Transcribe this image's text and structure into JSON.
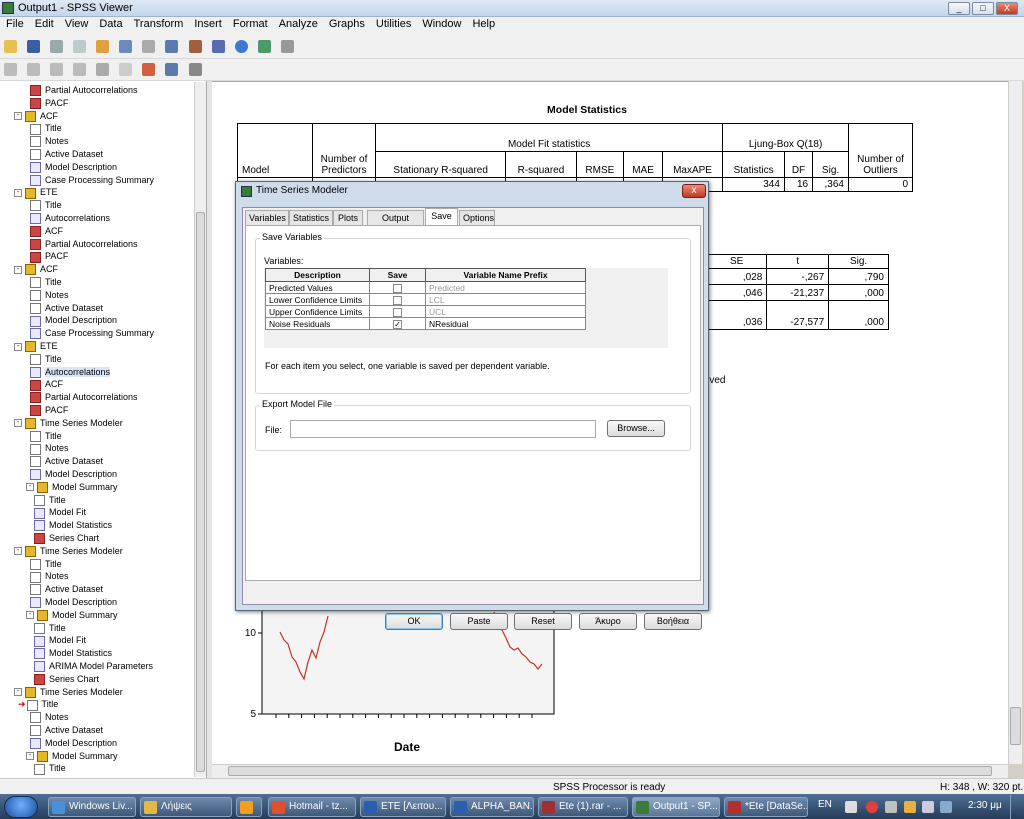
{
  "window": {
    "title": "Output1 - SPSS Viewer",
    "min": "_",
    "max": "□",
    "close": "X"
  },
  "menu": [
    "File",
    "Edit",
    "View",
    "Data",
    "Transform",
    "Insert",
    "Format",
    "Analyze",
    "Graphs",
    "Utilities",
    "Window",
    "Help"
  ],
  "tree": [
    {
      "label": "Partial Autocorrelations",
      "icon": "chart"
    },
    {
      "label": "PACF",
      "icon": "chart"
    },
    {
      "label": "ACF",
      "icon": "book",
      "level": "folder"
    },
    {
      "label": "Title",
      "icon": "page"
    },
    {
      "label": "Notes",
      "icon": "page"
    },
    {
      "label": "Active Dataset",
      "icon": "page"
    },
    {
      "label": "Model Description",
      "icon": "pivot"
    },
    {
      "label": "Case Processing Summary",
      "icon": "pivot"
    },
    {
      "label": "ETE",
      "icon": "book",
      "level": "folder"
    },
    {
      "label": "Title",
      "icon": "page"
    },
    {
      "label": "Autocorrelations",
      "icon": "pivot"
    },
    {
      "label": "ACF",
      "icon": "chart"
    },
    {
      "label": "Partial Autocorrelations",
      "icon": "chart"
    },
    {
      "label": "PACF",
      "icon": "chart"
    },
    {
      "label": "ACF",
      "icon": "book",
      "level": "folder"
    },
    {
      "label": "Title",
      "icon": "page"
    },
    {
      "label": "Notes",
      "icon": "page"
    },
    {
      "label": "Active Dataset",
      "icon": "page"
    },
    {
      "label": "Model Description",
      "icon": "pivot"
    },
    {
      "label": "Case Processing Summary",
      "icon": "pivot"
    },
    {
      "label": "ETE",
      "icon": "book",
      "level": "folder"
    },
    {
      "label": "Title",
      "icon": "page"
    },
    {
      "label": "Autocorrelations",
      "icon": "pivot",
      "selected": "true"
    },
    {
      "label": "ACF",
      "icon": "chart"
    },
    {
      "label": "Partial Autocorrelations",
      "icon": "chart"
    },
    {
      "label": "PACF",
      "icon": "chart"
    },
    {
      "label": "Time Series Modeler",
      "icon": "book",
      "level": "folder"
    },
    {
      "label": "Title",
      "icon": "page"
    },
    {
      "label": "Notes",
      "icon": "page"
    },
    {
      "label": "Active Dataset",
      "icon": "page"
    },
    {
      "label": "Model Description",
      "icon": "pivot"
    },
    {
      "label": "Model Summary",
      "icon": "book",
      "level": "sub"
    },
    {
      "label": "Title",
      "icon": "page"
    },
    {
      "label": "Model Fit",
      "icon": "pivot"
    },
    {
      "label": "Model Statistics",
      "icon": "pivot"
    },
    {
      "label": "Series Chart",
      "icon": "chart"
    },
    {
      "label": "Time Series Modeler",
      "icon": "book",
      "level": "folder"
    },
    {
      "label": "Title",
      "icon": "page"
    },
    {
      "label": "Notes",
      "icon": "page"
    },
    {
      "label": "Active Dataset",
      "icon": "page"
    },
    {
      "label": "Model Description",
      "icon": "pivot"
    },
    {
      "label": "Model Summary",
      "icon": "book",
      "level": "sub"
    },
    {
      "label": "Title",
      "icon": "page"
    },
    {
      "label": "Model Fit",
      "icon": "pivot"
    },
    {
      "label": "Model Statistics",
      "icon": "pivot"
    },
    {
      "label": "ARIMA Model Parameters",
      "icon": "pivot"
    },
    {
      "label": "Series Chart",
      "icon": "chart"
    },
    {
      "label": "Time Series Modeler",
      "icon": "book",
      "level": "folder"
    },
    {
      "label": "Title",
      "icon": "page",
      "arrow": "true"
    },
    {
      "label": "Notes",
      "icon": "page"
    },
    {
      "label": "Active Dataset",
      "icon": "page"
    },
    {
      "label": "Model Description",
      "icon": "pivot"
    },
    {
      "label": "Model Summary",
      "icon": "book",
      "level": "sub"
    },
    {
      "label": "Title",
      "icon": "page"
    }
  ],
  "output": {
    "model_stats_title": "Model Statistics",
    "h_model": "Model",
    "h_num_predictors": "Number of Predictors",
    "h_model_fit": "Model Fit statistics",
    "h_stat_rsq": "Stationary R-squared",
    "h_rsq": "R-squared",
    "h_rmse": "RMSE",
    "h_mae": "MAE",
    "h_maxape": "MaxAPE",
    "h_ljung": "Ljung-Box Q(18)",
    "h_statistics": "Statistics",
    "h_df": "DF",
    "h_sig": "Sig.",
    "h_outliers": "Number of Outliers",
    "row_stat_partial": "344",
    "row_df": "16",
    "row_sig": ",364",
    "row_outliers": "0",
    "param_headers": {
      "se": "SE",
      "t": "t",
      "sig": "Sig."
    },
    "param_rows": [
      {
        "se": ",028",
        "t": "-,267",
        "sig": ",790"
      },
      {
        "se": ",046",
        "t": "-21,237",
        "sig": ",000"
      },
      {
        "se": ",036",
        "t": "-27,577",
        "sig": ",000"
      }
    ],
    "observed_fragment": "rved",
    "chart_ylabels": [
      "10",
      "5"
    ],
    "chart_xlabel": "Date"
  },
  "dialog": {
    "title": "Time Series Modeler",
    "close": "x",
    "tabs": [
      "Variables",
      "Statistics",
      "Plots",
      "Output Filter",
      "Save",
      "Options"
    ],
    "active_tab": "Save",
    "save_group": "Save Variables",
    "variables_label": "Variables:",
    "col_description": "Description",
    "col_save": "Save",
    "col_prefix": "Variable Name Prefix",
    "rows": [
      {
        "desc": "Predicted Values",
        "checked": "",
        "prefix": "Predicted"
      },
      {
        "desc": "Lower Confidence Limits",
        "checked": "",
        "prefix": "LCL"
      },
      {
        "desc": "Upper Confidence Limits",
        "checked": "",
        "prefix": "UCL"
      },
      {
        "desc": "Noise Residuals",
        "checked": "✓",
        "prefix": "NResidual"
      }
    ],
    "note": "For each item you select, one variable is saved per dependent variable.",
    "export_group": "Export Model File",
    "file_label": "File:",
    "file_value": "",
    "browse": "Browse...",
    "buttons": {
      "ok": "OK",
      "paste": "Paste",
      "reset": "Reset",
      "cancel": "Άκυρο",
      "help": "Βοήθεια"
    }
  },
  "status": {
    "processor": "SPSS Processor is ready",
    "dims": "H: 348 , W: 320  pt."
  },
  "taskbar": {
    "tasks": [
      {
        "label": "Windows Liv...",
        "color": "#4a8fd8"
      },
      {
        "label": "Λήψεις",
        "color": "#e2b84a"
      },
      {
        "label": "",
        "color": "#f0a020"
      },
      {
        "label": "Hotmail - tz...",
        "color": "#e05030"
      },
      {
        "label": "ETE [Λειτου...",
        "color": "#2a5fb0"
      },
      {
        "label": "ALPHA_BAN...",
        "color": "#2a5fb0"
      },
      {
        "label": "Ete (1).rar - ...",
        "color": "#a03030"
      },
      {
        "label": "Output1 - SP...",
        "color": "#3a7a3a"
      },
      {
        "label": "*Ete [DataSe...",
        "color": "#b03030"
      }
    ],
    "lang": "EN",
    "clock": "2:30 μμ"
  }
}
